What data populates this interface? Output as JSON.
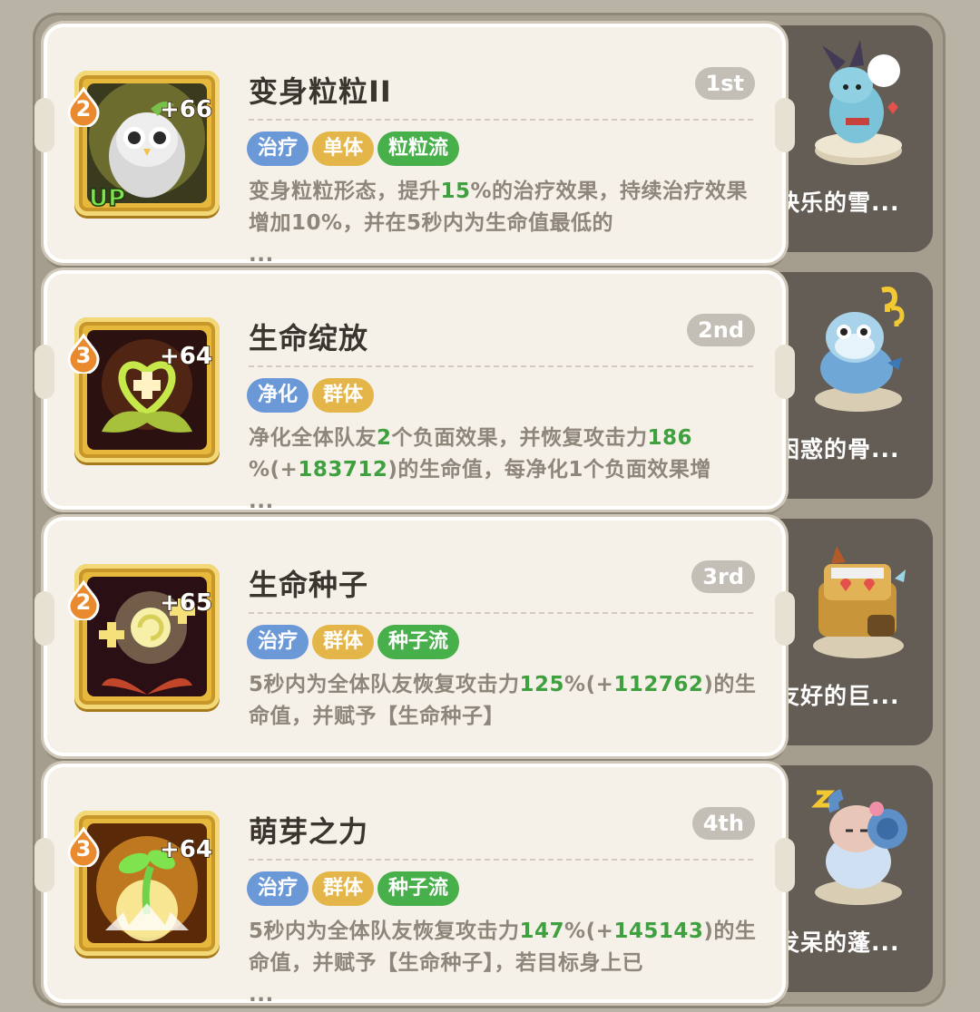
{
  "rows": [
    {
      "title": "变身粒粒II",
      "rank": "1st",
      "level": "2",
      "bonus": "+66",
      "up_badge": "UP",
      "tags": [
        {
          "label": "治疗",
          "color": "#6b98d6"
        },
        {
          "label": "单体",
          "color": "#e4b64a"
        },
        {
          "label": "粒粒流",
          "color": "#48b04a"
        }
      ],
      "desc": {
        "p1": "变身粒粒形态，提升",
        "h1": "15",
        "p2": "%的治疗效果，持续治疗效果增加10%，并在5秒内为生命值最低的",
        "ellipsis": "..."
      },
      "pet_name": "快乐的雪...",
      "pet_icon": "snowball-creature-icon"
    },
    {
      "title": "生命绽放",
      "rank": "2nd",
      "level": "3",
      "bonus": "+64",
      "tags": [
        {
          "label": "净化",
          "color": "#6b98d6"
        },
        {
          "label": "群体",
          "color": "#e4b64a"
        }
      ],
      "desc": {
        "p1": "净化全体队友",
        "h1": "2",
        "p2": "个负面效果，并恢复攻击力",
        "h2": "186",
        "p3": "%(+",
        "h3": "183712",
        "p4": ")的生命值，每净化1个负面效果增",
        "ellipsis": "..."
      },
      "pet_name": "困惑的骨...",
      "pet_icon": "confused-dragon-icon"
    },
    {
      "title": "生命种子",
      "rank": "3rd",
      "level": "2",
      "bonus": "+65",
      "tags": [
        {
          "label": "治疗",
          "color": "#6b98d6"
        },
        {
          "label": "群体",
          "color": "#e4b64a"
        },
        {
          "label": "种子流",
          "color": "#48b04a"
        }
      ],
      "desc": {
        "p1": "5秒内为全体队友恢复攻击力",
        "h1": "125",
        "p2": "%(+",
        "h2": "112762",
        "p3": ")的生命值，并赋予【生命种子】"
      },
      "pet_name": "友好的巨...",
      "pet_icon": "friendly-golem-icon"
    },
    {
      "title": "萌芽之力",
      "rank": "4th",
      "level": "3",
      "bonus": "+64",
      "tags": [
        {
          "label": "治疗",
          "color": "#6b98d6"
        },
        {
          "label": "群体",
          "color": "#e4b64a"
        },
        {
          "label": "种子流",
          "color": "#48b04a"
        }
      ],
      "desc": {
        "p1": "5秒内为全体队友恢复攻击力",
        "h1": "147",
        "p2": "%(+",
        "h2": "145143",
        "p3": ")的生命值，并赋予【生命种子】，若目标身上已",
        "ellipsis": "..."
      },
      "pet_name": "发呆的蓬...",
      "pet_icon": "sleepy-ram-icon"
    }
  ]
}
